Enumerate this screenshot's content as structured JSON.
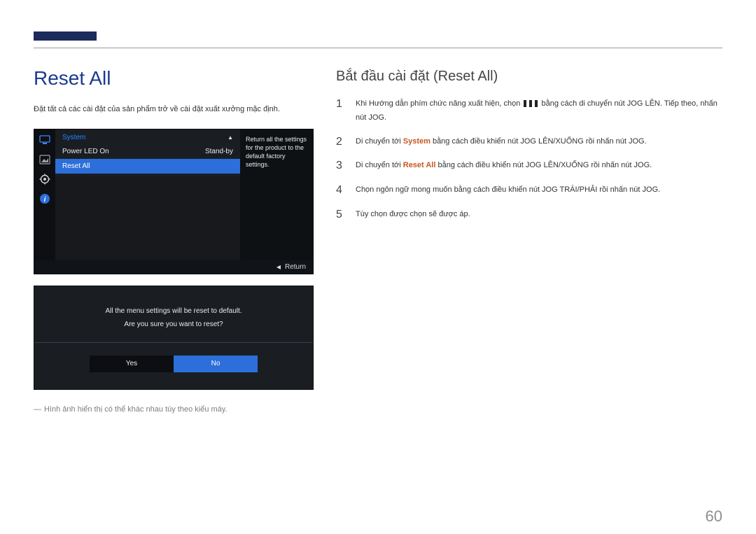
{
  "page_number": "60",
  "left": {
    "heading": "Reset All",
    "description": "Đặt tất cả các cài đặt của sản phẩm trở về cài đặt xuất xưởng mặc định.",
    "osd": {
      "section_title": "System",
      "row1_label": "Power LED On",
      "row1_value": "Stand-by",
      "row2_label": "Reset All",
      "help_text": "Return all the settings for the product to the default factory settings.",
      "footer_label": "Return"
    },
    "confirm": {
      "line1": "All the menu settings will be reset to default.",
      "line2": "Are you sure you want to reset?",
      "yes": "Yes",
      "no": "No"
    },
    "note": "Hình ảnh hiển thị có thể khác nhau tùy theo kiểu máy."
  },
  "right": {
    "heading": "Bắt đầu cài đặt (Reset All)",
    "steps": [
      {
        "num": "1",
        "pre": "Khi Hướng dẫn phím chức năng xuất hiện, chọn ",
        "post": " bằng cách di chuyển nút JOG LÊN. Tiếp theo, nhấn nút JOG."
      },
      {
        "num": "2",
        "pre": "Di chuyển tới ",
        "kw": "System",
        "post": " bằng cách điều khiển nút JOG LÊN/XUỐNG rồi nhấn nút JOG."
      },
      {
        "num": "3",
        "pre": "Di chuyển tới ",
        "kw": "Reset All",
        "post": " bằng cách điều khiển nút JOG LÊN/XUỐNG rồi nhấn nút JOG."
      },
      {
        "num": "4",
        "text": "Chọn ngôn ngữ mong muốn bằng cách điều khiển nút JOG TRÁI/PHẢI rồi nhấn nút JOG."
      },
      {
        "num": "5",
        "text": "Tùy chọn được chọn sẽ được áp."
      }
    ]
  }
}
